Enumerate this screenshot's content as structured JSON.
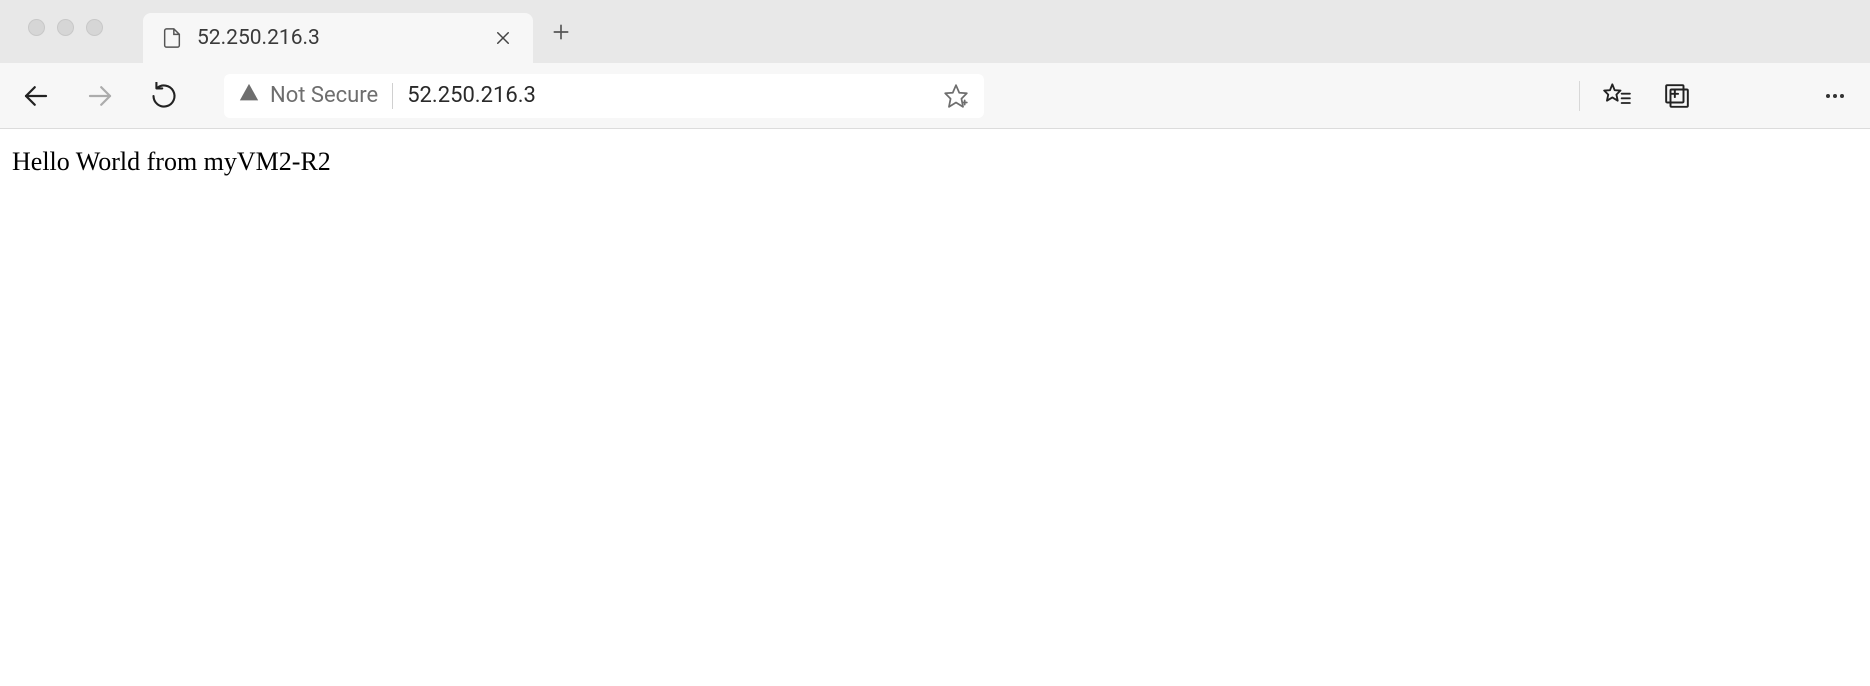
{
  "tab": {
    "title": "52.250.216.3"
  },
  "addressbar": {
    "security_label": "Not Secure",
    "url": "52.250.216.3"
  },
  "page": {
    "body_text": "Hello World from myVM2-R2"
  }
}
